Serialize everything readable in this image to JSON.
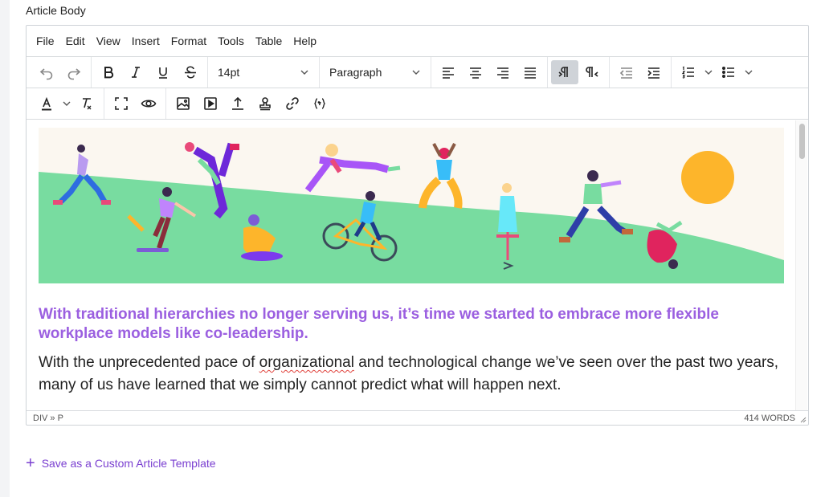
{
  "field": {
    "label": "Article Body"
  },
  "menubar": {
    "items": [
      "File",
      "Edit",
      "View",
      "Insert",
      "Format",
      "Tools",
      "Table",
      "Help"
    ]
  },
  "toolbar": {
    "font_size": "14pt",
    "block_format": "Paragraph"
  },
  "content": {
    "lead": "With traditional hierarchies no longer serving us, it’s time we started to embrace more flexible workplace models like co-leadership.",
    "body_before": "With the unprecedented pace of ",
    "body_misspelled": "organizational",
    "body_after": " and technological change we’ve seen over the past two years, many of us have learned that we simply cannot predict what will happen next."
  },
  "statusbar": {
    "path": "DIV » P",
    "word_count": "414 WORDS"
  },
  "footer": {
    "template_link": "Save as a Custom Article Template"
  },
  "colors": {
    "accent": "#9b5fe0",
    "link": "#7a3fd0",
    "banner_bg": "#fbf7f0",
    "grass": "#78dca0",
    "sun": "#fdb52b"
  }
}
